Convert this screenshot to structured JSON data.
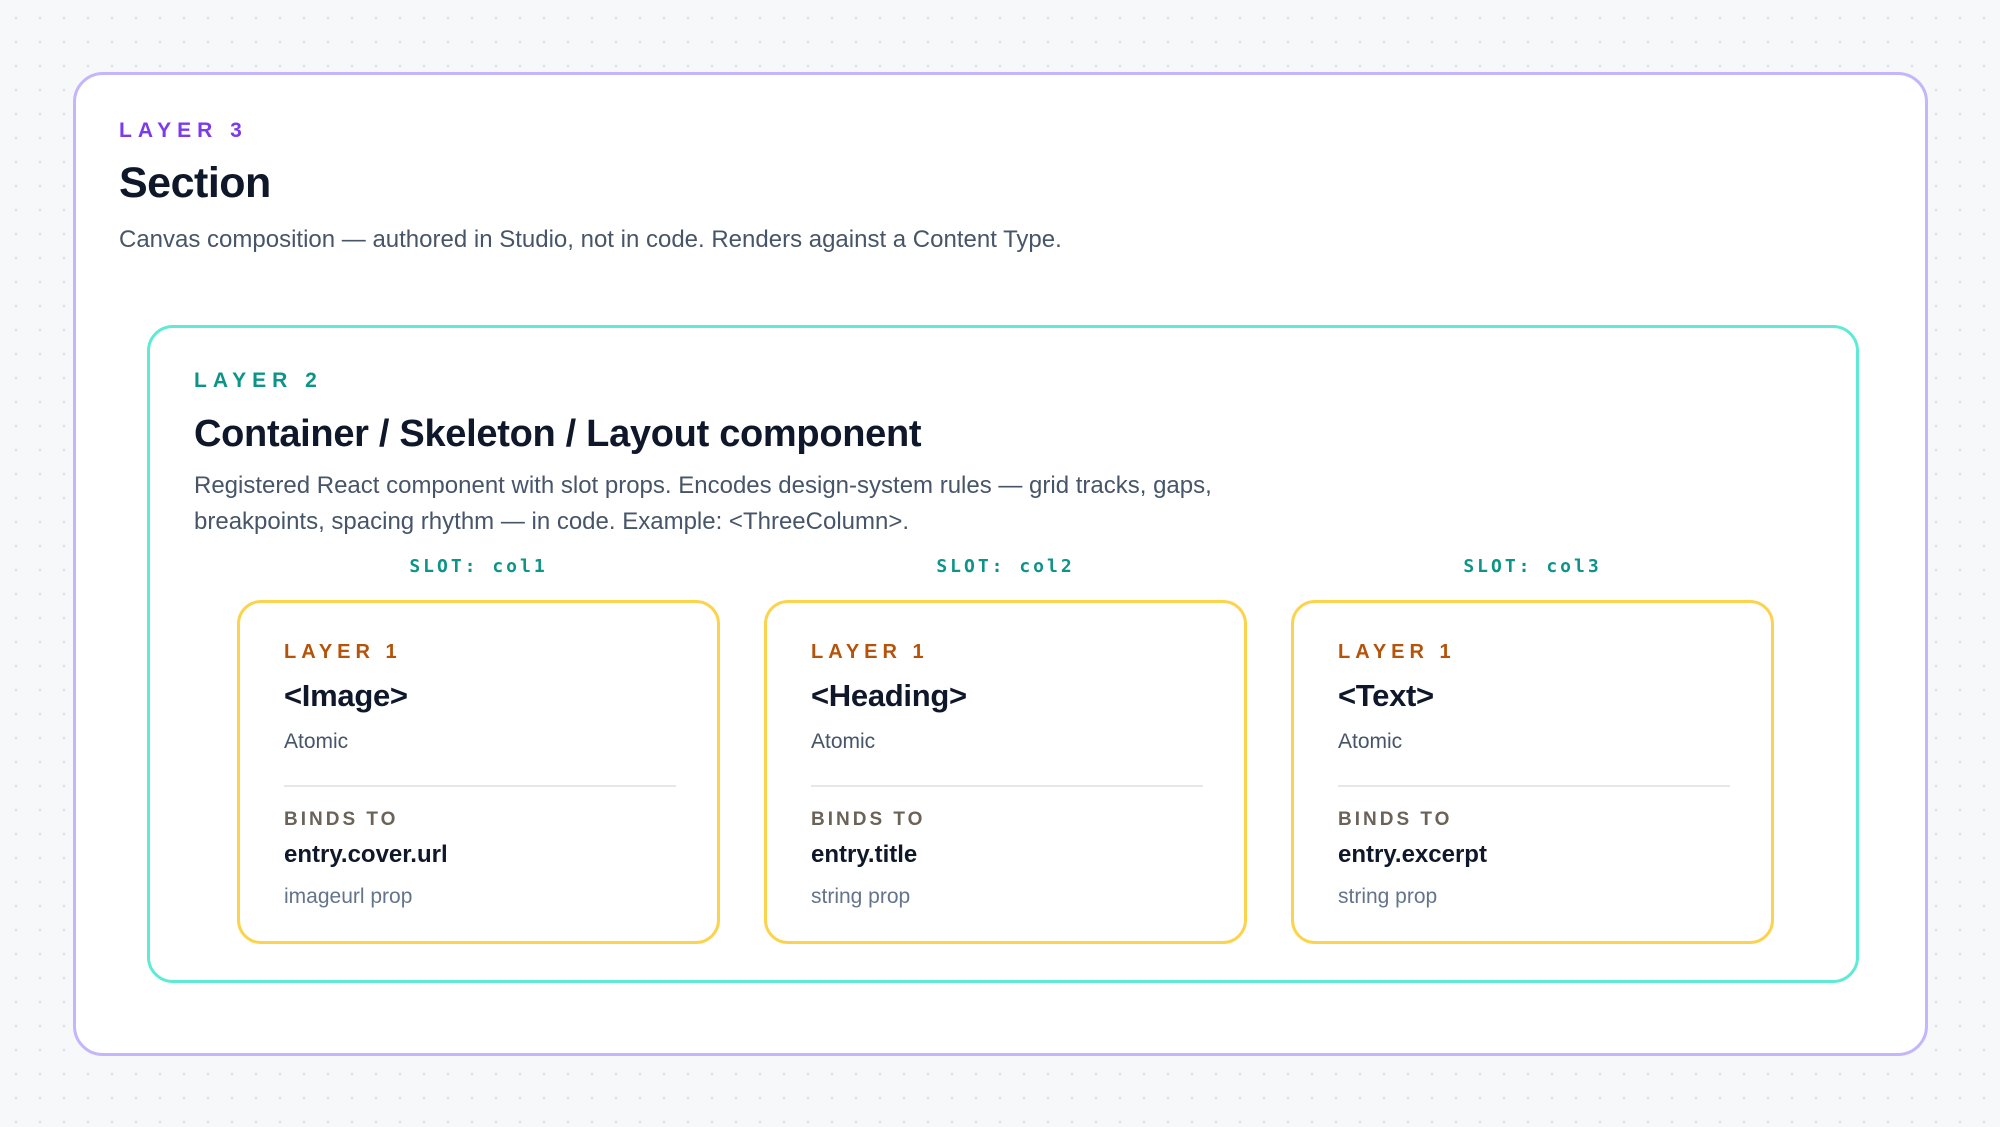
{
  "section": {
    "eyebrow": "LAYER 3",
    "title": "Section",
    "description": "Canvas composition — authored in Studio, not in code. Renders against a Content Type."
  },
  "container": {
    "eyebrow": "LAYER 2",
    "title": "Container / Skeleton / Layout component",
    "description": "Registered React component with slot props. Encodes design-system rules — grid tracks, gaps, breakpoints, spacing rhythm — in code. Example: <ThreeColumn>."
  },
  "slots": [
    {
      "slot_label": "SLOT: col1",
      "eyebrow": "LAYER 1",
      "title": "<Image>",
      "subtitle": "Atomic",
      "binds_label": "BINDS TO",
      "binds_value": "entry.cover.url",
      "binds_type": "imageurl prop"
    },
    {
      "slot_label": "SLOT: col2",
      "eyebrow": "LAYER 1",
      "title": "<Heading>",
      "subtitle": "Atomic",
      "binds_label": "BINDS TO",
      "binds_value": "entry.title",
      "binds_type": "string prop"
    },
    {
      "slot_label": "SLOT: col3",
      "eyebrow": "LAYER 1",
      "title": "<Text>",
      "subtitle": "Atomic",
      "binds_label": "BINDS TO",
      "binds_value": "entry.excerpt",
      "binds_type": "string prop"
    }
  ],
  "colors": {
    "layer3_accent": "#7c3aed",
    "layer3_border": "#c4b5fd",
    "layer2_accent": "#0d9488",
    "layer2_border": "#5eead4",
    "layer1_accent": "#b45309",
    "layer1_border": "#fcd34d"
  }
}
